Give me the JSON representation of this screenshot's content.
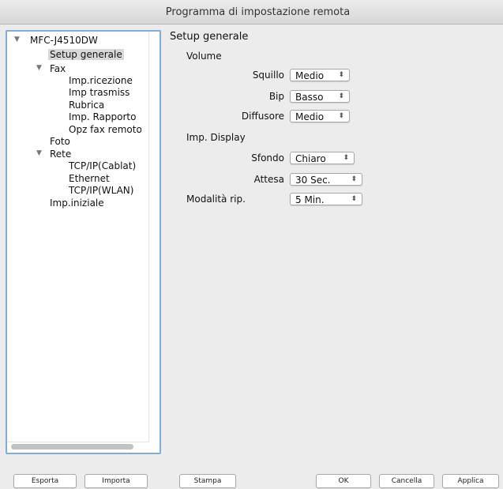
{
  "window": {
    "title": "Programma di impostazione remota"
  },
  "tree": {
    "root": "MFC-J4510DW",
    "setup": "Setup generale",
    "fax": "Fax",
    "fax_ricezione": "Imp.ricezione",
    "fax_trasmiss": "Imp trasmiss",
    "fax_rubrica": "Rubrica",
    "fax_rapporto": "Imp. Rapporto",
    "fax_remoto": "Opz fax remoto",
    "foto": "Foto",
    "rete": "Rete",
    "rete_cablat": "TCP/IP(Cablat)",
    "rete_ethernet": "Ethernet",
    "rete_wlan": "TCP/IP(WLAN)",
    "iniziale": "Imp.iniziale"
  },
  "main": {
    "title": "Setup generale",
    "volume": {
      "section": "Volume",
      "squillo_label": "Squillo",
      "squillo_value": "Medio",
      "bip_label": "Bip",
      "bip_value": "Basso",
      "diffusore_label": "Diffusore",
      "diffusore_value": "Medio"
    },
    "display": {
      "section": "Imp. Display",
      "sfondo_label": "Sfondo",
      "sfondo_value": "Chiaro",
      "attesa_label": "Attesa",
      "attesa_value": "30 Sec."
    },
    "sleep": {
      "label": "Modalità rip.",
      "value": "5 Min."
    }
  },
  "buttons": {
    "esporta": "Esporta",
    "importa": "Importa",
    "stampa": "Stampa",
    "ok": "OK",
    "cancella": "Cancella",
    "applica": "Applica"
  },
  "icons": {
    "expanded": "disclosure-triangle-down",
    "select": "updown-arrows"
  },
  "colors": {
    "focus_ring": "#7fadde",
    "selection": "#d8d8d8"
  }
}
